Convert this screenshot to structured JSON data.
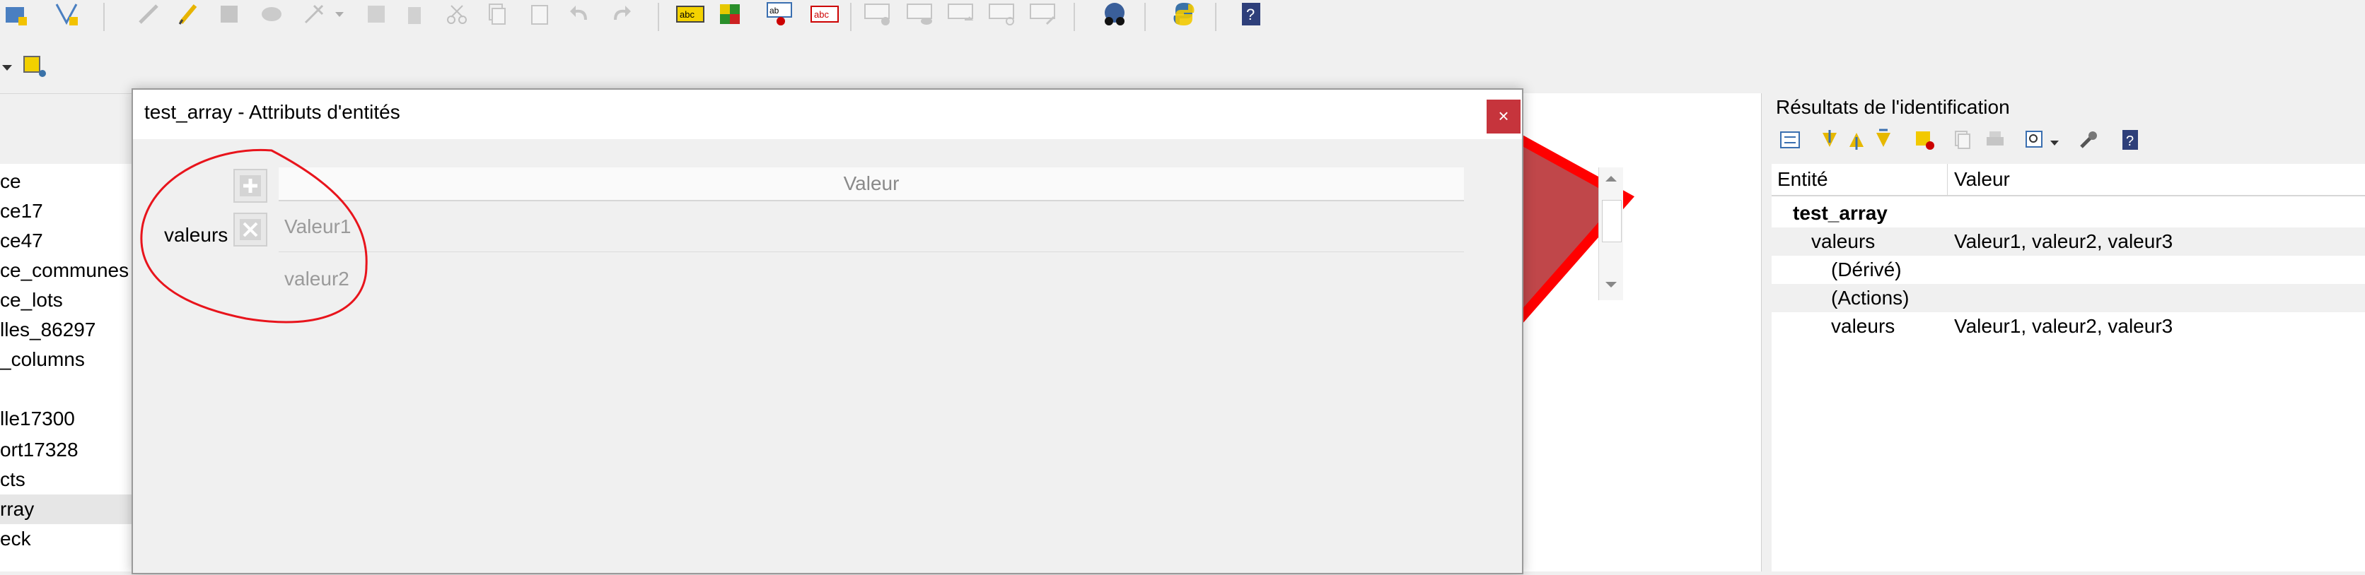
{
  "toolbar": {
    "icons": [
      "project-icon",
      "style-icon",
      "edit-pencil-icon",
      "toggle-edit-icon",
      "save-edits-icon",
      "add-feature-icon",
      "vertex-tool-icon",
      "dropdown-arrow-icon",
      "modify-attributes-icon",
      "delete-selected-icon",
      "cut-icon",
      "copy-icon",
      "paste-icon",
      "undo-icon",
      "redo-icon",
      "label-abc-icon",
      "diagram-icon",
      "label-pin-icon",
      "label-red-icon",
      "label-disabled-icon",
      "label-show-icon",
      "label-move-icon",
      "label-rotate-icon",
      "label-change-icon",
      "plugin-globe-icon",
      "python-icon",
      "help-icon"
    ]
  },
  "layers": {
    "items": [
      "ce",
      "ce17",
      "ce47",
      "ce_communes",
      "ce_lots",
      "lles_86297",
      "_columns",
      "",
      "lle17300",
      "ort17328",
      "cts",
      "rray",
      "eck"
    ]
  },
  "dialog": {
    "title": "test_array - Attributs d'entités",
    "close_label": "×",
    "field_label": "valeurs",
    "grid_header": "Valeur",
    "rows": [
      "Valeur1",
      "valeur2"
    ]
  },
  "right_panel": {
    "title": "Résultats de l'identification",
    "col_entity": "Entité",
    "col_value": "Valeur",
    "tree": {
      "root": "test_array",
      "field_name": "valeurs",
      "field_value": "Valeur1, valeur2, valeur3",
      "derived": "(Dérivé)",
      "actions": "(Actions)",
      "leaf_name": "valeurs",
      "leaf_value": "Valeur1, valeur2, valeur3"
    }
  },
  "colors": {
    "annotation": "#e8141c",
    "polygon_fill": "#c0474a",
    "polygon_stroke": "#ff0000",
    "close_button": "#c6343c"
  }
}
